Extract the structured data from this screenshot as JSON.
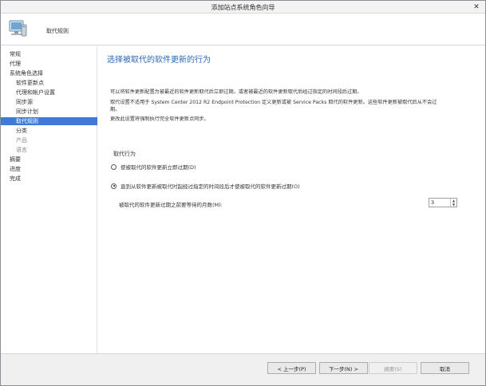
{
  "window": {
    "title": "添加站点系统角色向导",
    "close_glyph": "✕"
  },
  "header": {
    "title": "取代规则",
    "icon": "computer-icon"
  },
  "sidebar": {
    "items": [
      {
        "label": "常规",
        "level": 0,
        "state": "normal"
      },
      {
        "label": "代理",
        "level": 0,
        "state": "normal"
      },
      {
        "label": "系统角色选择",
        "level": 0,
        "state": "normal"
      },
      {
        "label": "软件更新点",
        "level": 1,
        "state": "normal"
      },
      {
        "label": "代理和帐户设置",
        "level": 1,
        "state": "normal"
      },
      {
        "label": "同步源",
        "level": 1,
        "state": "normal"
      },
      {
        "label": "同步计划",
        "level": 1,
        "state": "normal"
      },
      {
        "label": "取代规则",
        "level": 1,
        "state": "active"
      },
      {
        "label": "分类",
        "level": 1,
        "state": "normal"
      },
      {
        "label": "产品",
        "level": 1,
        "state": "muted"
      },
      {
        "label": "语言",
        "level": 1,
        "state": "muted"
      },
      {
        "label": "摘要",
        "level": 0,
        "state": "normal"
      },
      {
        "label": "进度",
        "level": 0,
        "state": "normal"
      },
      {
        "label": "完成",
        "level": 0,
        "state": "normal"
      }
    ]
  },
  "main": {
    "title": "选择被取代的软件更新的行为",
    "para1": "可以将软件更新配置为被最近的软件更新取代后立即过期，或者被最近的软件更新取代后经过指定的时间段后过期。",
    "para2_line1": "取代设置不适用于 System Center 2012 R2 Endpoint Protection 定义更新或被 Service Packs 取代的软件更新。这些软件更新被取代后从不会过",
    "para2_line2": "期。",
    "para3": "更改此设置将强制执行完全软件更新点同步。",
    "group_label": "取代行为",
    "option1": "使被取代的软件更新立即过期(D)",
    "option2": "直到从软件更新被取代时起经过指定的时间段后才使被取代的软件更新过期(O)",
    "selected_option": 2,
    "months_label": "被取代的软件更新过期之前要等待的月数(M):",
    "months_value": "3",
    "arrow_up": "▲",
    "arrow_down": "▼"
  },
  "footer": {
    "prev": "< 上一步(P)",
    "next": "下一步(N) >",
    "summary": "摘要(S)",
    "cancel": "取消"
  }
}
